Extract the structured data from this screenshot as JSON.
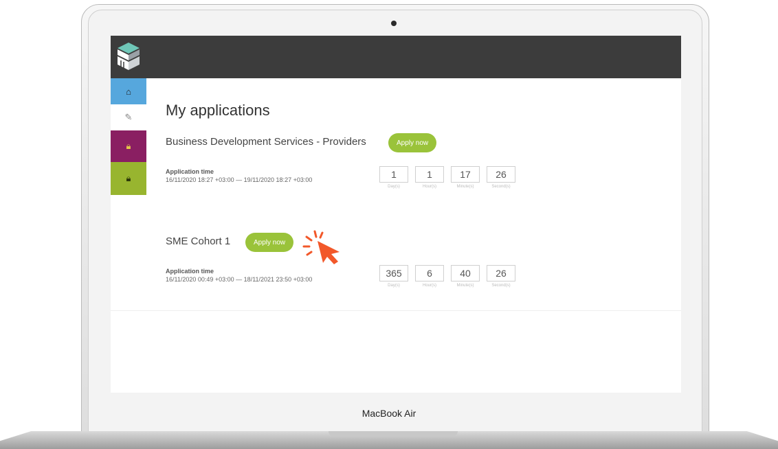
{
  "device": {
    "label": "MacBook Air"
  },
  "nav": {
    "items": [
      {
        "icon": "home-icon",
        "glyph": "⌂"
      },
      {
        "icon": "edit-icon",
        "glyph": "✎"
      },
      {
        "icon": "lock-icon",
        "glyph": "🔒︎"
      },
      {
        "icon": "lock-icon",
        "glyph": "🔒︎"
      }
    ]
  },
  "page": {
    "title": "My applications"
  },
  "applications": [
    {
      "name": "Business Development Services - Providers",
      "apply_label": "Apply now",
      "time_label": "Application time",
      "time_range": "16/11/2020 18:27 +03:00 — 19/11/2020 18:27 +03:00",
      "countdown": [
        {
          "value": "1",
          "unit": "Day(s)"
        },
        {
          "value": "1",
          "unit": "Hour(s)"
        },
        {
          "value": "17",
          "unit": "Minute(s)"
        },
        {
          "value": "26",
          "unit": "Second(s)"
        }
      ]
    },
    {
      "name": "SME Cohort 1",
      "apply_label": "Apply now",
      "time_label": "Application time",
      "time_range": "16/11/2020 00:49 +03:00 — 18/11/2021 23:50 +03:00",
      "countdown": [
        {
          "value": "365",
          "unit": "Day(s)"
        },
        {
          "value": "6",
          "unit": "Hour(s)"
        },
        {
          "value": "40",
          "unit": "Minute(s)"
        },
        {
          "value": "26",
          "unit": "Second(s)"
        }
      ]
    }
  ],
  "colors": {
    "topbar": "#3c3c3c",
    "accent_green": "#9ac33a",
    "nav_home": "#56a7dd",
    "nav_purple": "#8a1f62",
    "nav_olive": "#98b52f",
    "cursor": "#f2582a"
  }
}
